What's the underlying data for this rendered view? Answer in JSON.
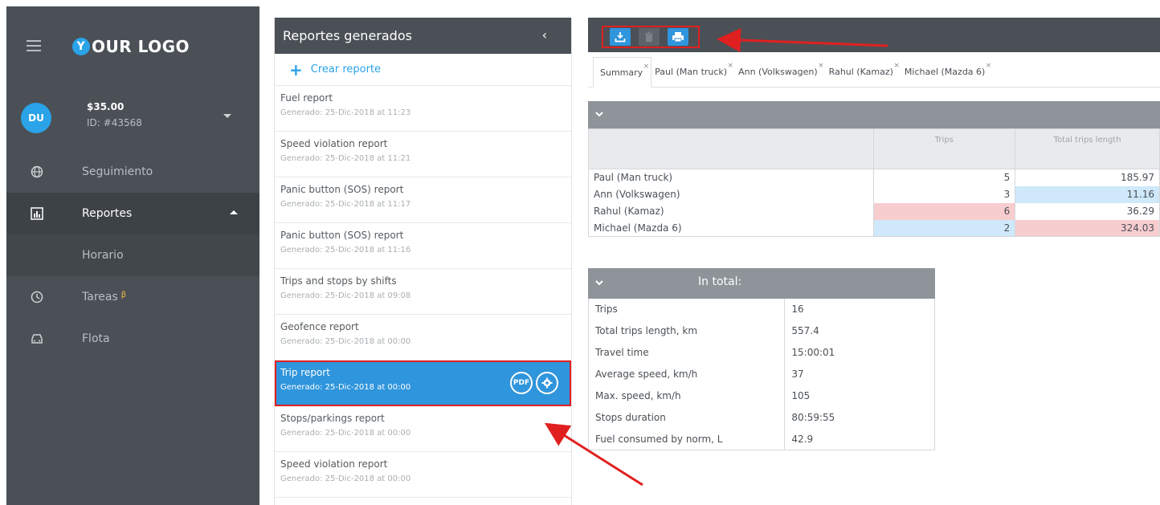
{
  "sidebar": {
    "logo_mark": "Y",
    "logo_text": "OUR LOGO",
    "user": {
      "initials": "DU",
      "balance": "$35.00",
      "id": "ID: #43568"
    },
    "items": [
      {
        "label": "Seguimiento",
        "icon": "globe-icon"
      },
      {
        "label": "Reportes",
        "icon": "chart-icon"
      },
      {
        "label": "Horario"
      },
      {
        "label": "Tareas",
        "icon": "clock-icon",
        "badge": "β"
      },
      {
        "label": "Flota",
        "icon": "car-icon"
      }
    ]
  },
  "reports": {
    "title": "Reportes generados",
    "collapse": "‹",
    "create_label": "Crear reporte",
    "items": [
      {
        "title": "Fuel report",
        "date": "Generado: 25-Dic-2018 at 11:23"
      },
      {
        "title": "Speed violation report",
        "date": "Generado: 25-Dic-2018 at 11:21"
      },
      {
        "title": "Panic button (SOS) report",
        "date": "Generado: 25-Dic-2018 at 11:17"
      },
      {
        "title": "Panic button (SOS) report",
        "date": "Generado: 25-Dic-2018 at 11:16"
      },
      {
        "title": "Trips and stops by shifts",
        "date": "Generado: 25-Dic-2018 at 09:08"
      },
      {
        "title": "Geofence report",
        "date": "Generado: 25-Dic-2018 at 00:00"
      },
      {
        "title": "Trip report",
        "date": "Generado: 25-Dic-2018 at 00:00",
        "pdf": "PDF"
      },
      {
        "title": "Stops/parkings report",
        "date": "Generado: 25-Dic-2018 at 00:00"
      },
      {
        "title": "Speed violation report",
        "date": "Generado: 25-Dic-2018 at 00:00"
      }
    ]
  },
  "main": {
    "tabs": [
      "Summary",
      "Paul (Man truck)",
      "Ann (Volkswagen)",
      "Rahul (Kamaz)",
      "Michael (Mazda 6)"
    ],
    "tab_close": "×",
    "summary": {
      "headers": [
        "",
        "Trips",
        "Total trips length"
      ],
      "rows": [
        {
          "name": "Paul (Man truck)",
          "trips": "5",
          "length": "185.97"
        },
        {
          "name": "Ann (Volkswagen)",
          "trips": "3",
          "length": "11.16"
        },
        {
          "name": "Rahul (Kamaz)",
          "trips": "6",
          "length": "36.29"
        },
        {
          "name": "Michael (Mazda 6)",
          "trips": "2",
          "length": "324.03"
        }
      ]
    },
    "total": {
      "title": "In total:",
      "rows": [
        {
          "label": "Trips",
          "value": "16"
        },
        {
          "label": "Total trips length, km",
          "value": "557.4"
        },
        {
          "label": "Travel time",
          "value": "15:00:01"
        },
        {
          "label": "Average speed, km/h",
          "value": "37"
        },
        {
          "label": "Max. speed, km/h",
          "value": "105"
        },
        {
          "label": "Stops duration",
          "value": "80:59:55"
        },
        {
          "label": "Fuel consumed by norm, L",
          "value": "42.9"
        }
      ]
    }
  },
  "colors": {
    "accent": "#2f95dc",
    "sidebar_bg": "#4a5056",
    "highlight_red": "#e02020",
    "cell_blue": "#cfe8fa",
    "cell_red": "#f8cdd0"
  }
}
